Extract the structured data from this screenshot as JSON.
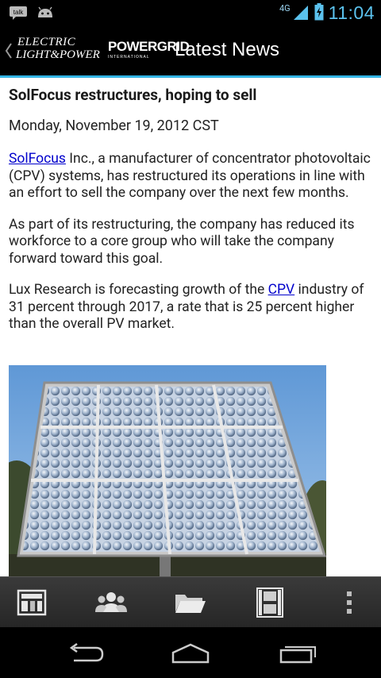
{
  "status_bar": {
    "left_icons": [
      "talk-icon",
      "android-icon"
    ],
    "network": "4G",
    "time": "11:04"
  },
  "app_bar": {
    "logo_electric_line1": "ELECTRIC",
    "logo_electric_line2": "LIGHT&POWER",
    "logo_powergrid": "POWERGRID",
    "logo_powergrid_sub": "INTERNATIONAL",
    "title": "Latest News"
  },
  "article": {
    "headline": "SolFocus restructures, hoping to sell",
    "date": "Monday, November 19, 2012 CST",
    "p1_link": "SolFocus",
    "p1_text": " Inc., a manufacturer of concentrator photovoltaic (CPV) systems, has restructured its operations in line with an effort to sell the company over the next few months.",
    "p2_text": "As part of its restructuring, the company has reduced its workforce to a core group who will take the company forward toward this goal.",
    "p3_before": "Lux Research is forecasting growth of the ",
    "p3_link": "CPV",
    "p3_after": " industry of 31 percent through 2017, a rate that is 25 percent higher than the overall PV market."
  },
  "toolbar": {
    "icons": [
      "news-icon",
      "people-icon",
      "folder-icon",
      "film-icon",
      "overflow-menu-icon"
    ]
  },
  "colors": {
    "accent": "#33b5e5",
    "link": "#0000cc",
    "time": "#5bc2ee"
  }
}
